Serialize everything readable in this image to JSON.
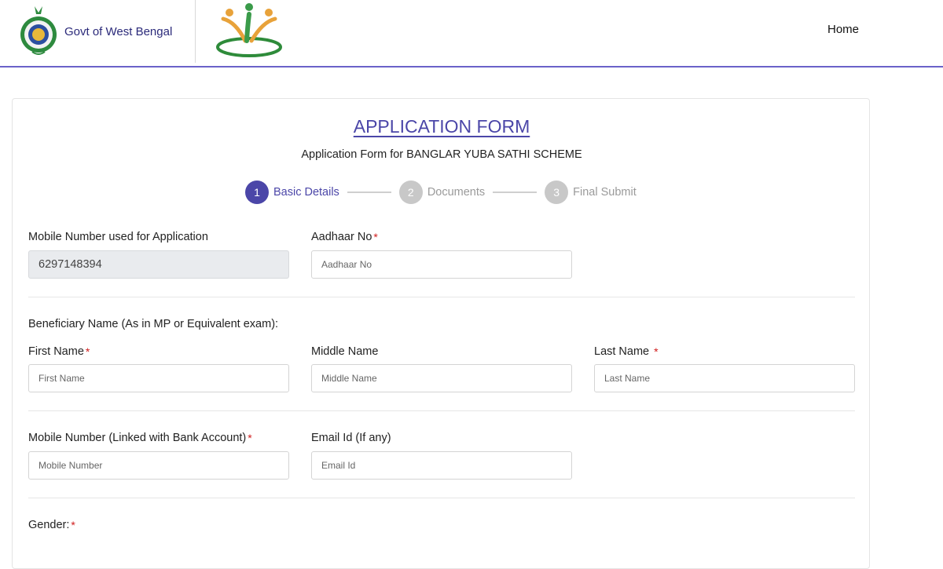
{
  "header": {
    "gov_name": "Govt of West Bengal",
    "nav_home": "Home",
    "accent": "#6a62c9"
  },
  "form": {
    "title": "APPLICATION FORM",
    "subtitle": "Application Form for BANGLAR YUBA SATHI SCHEME",
    "title_color": "#4b46a8"
  },
  "stepper": {
    "steps": [
      {
        "number": "1",
        "label": "Basic Details",
        "state": "active"
      },
      {
        "number": "2",
        "label": "Documents",
        "state": "inactive"
      },
      {
        "number": "3",
        "label": "Final Submit",
        "state": "inactive"
      }
    ]
  },
  "fields": {
    "mobile_app": {
      "label": "Mobile Number used for Application",
      "value": "6297148394"
    },
    "aadhaar": {
      "label": "Aadhaar No",
      "required": "*",
      "placeholder": "Aadhaar No"
    },
    "beneficiary_heading": "Beneficiary Name (As in MP or Equivalent exam):",
    "first_name": {
      "label": "First Name",
      "required": "*",
      "placeholder": "First Name"
    },
    "middle_name": {
      "label": "Middle Name",
      "placeholder": "Middle Name"
    },
    "last_name": {
      "label": "Last Name ",
      "required": "*",
      "placeholder": "Last Name"
    },
    "mobile_bank": {
      "label": "Mobile Number (Linked with Bank Account)",
      "required": "*",
      "placeholder": "Mobile Number"
    },
    "email": {
      "label": "Email Id (If any)",
      "placeholder": "Email Id"
    },
    "gender": {
      "label": "Gender:",
      "required": "*"
    }
  }
}
